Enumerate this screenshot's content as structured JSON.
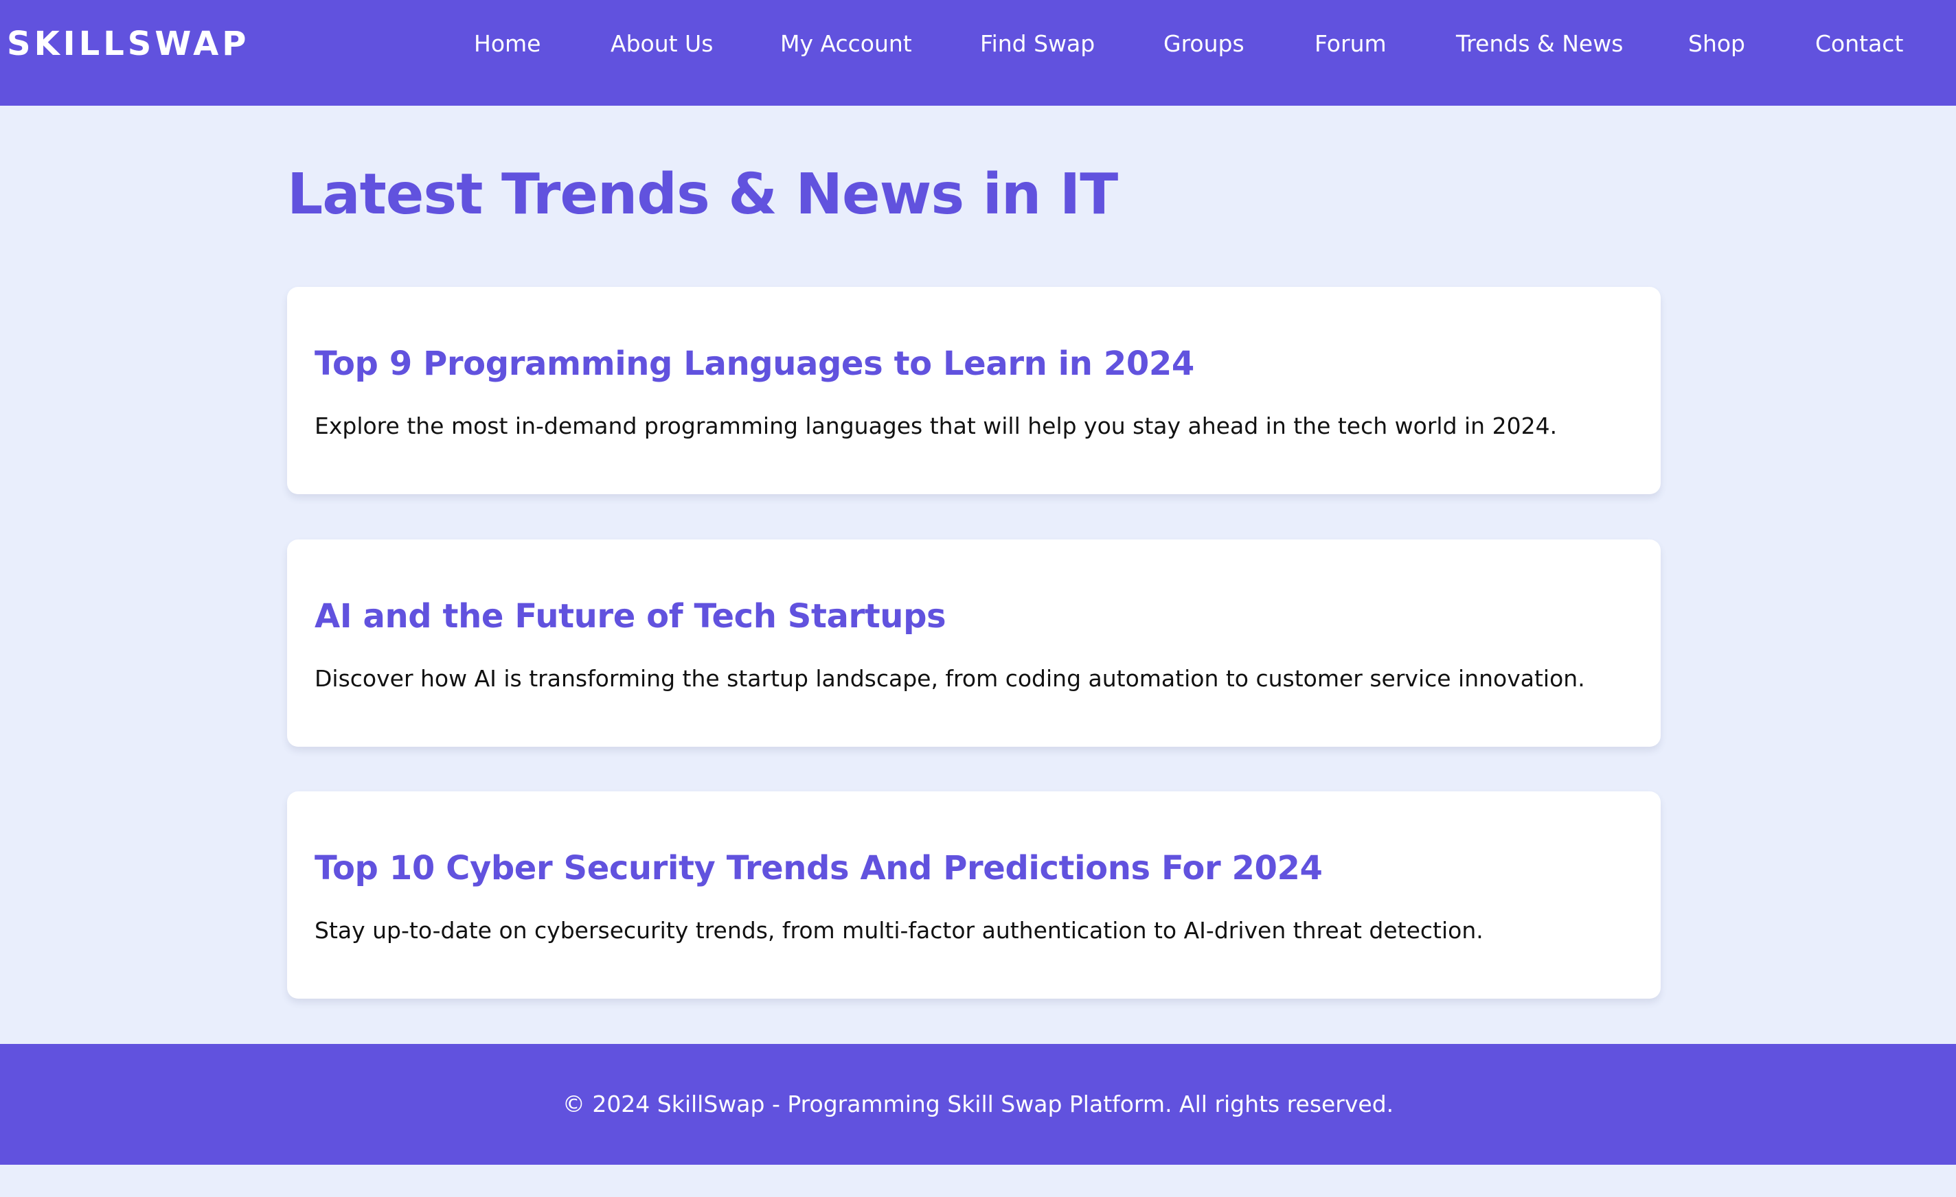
{
  "site": {
    "logo": "SKILLSWAP"
  },
  "nav": {
    "items": [
      {
        "label": "Home"
      },
      {
        "label": "About Us"
      },
      {
        "label": "My Account"
      },
      {
        "label": "Find Swap"
      },
      {
        "label": "Groups"
      },
      {
        "label": "Forum"
      },
      {
        "label": "Trends & News"
      },
      {
        "label": "Shop"
      },
      {
        "label": "Contact"
      }
    ]
  },
  "main": {
    "title": "Latest Trends & News in IT",
    "articles": [
      {
        "title": "Top 9 Programming Languages to Learn in 2024",
        "description": "Explore the most in-demand programming languages that will help you stay ahead in the tech world in 2024."
      },
      {
        "title": "AI and the Future of Tech Startups",
        "description": "Discover how AI is transforming the startup landscape, from coding automation to customer service innovation."
      },
      {
        "title": "Top 10 Cyber Security Trends And Predictions For 2024",
        "description": "Stay up-to-date on cybersecurity trends, from multi-factor authentication to AI-driven threat detection."
      }
    ]
  },
  "footer": {
    "text": "© 2024 SkillSwap - Programming Skill Swap Platform. All rights reserved."
  },
  "colors": {
    "brand": "#6152de",
    "background": "#e9eefc",
    "card": "#ffffff",
    "body_text": "#111111"
  }
}
